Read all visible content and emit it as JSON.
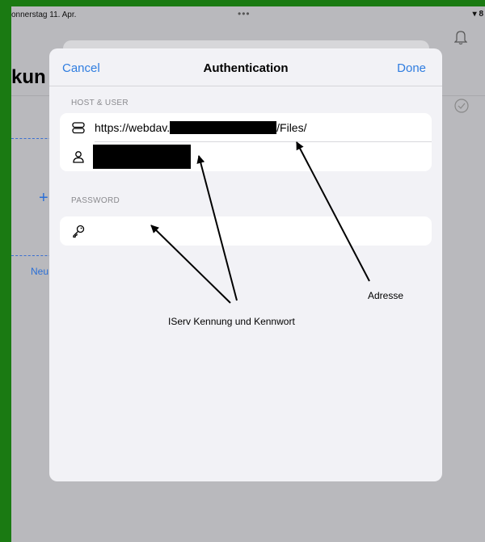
{
  "status_bar": {
    "date": "onnerstag 11. Apr.",
    "dots": "•••",
    "right": "8"
  },
  "background": {
    "title": "kun",
    "new_label": "Neu",
    "plus_symbol": "+"
  },
  "sheet": {
    "nav": {
      "cancel": "Cancel",
      "title": "Authentication",
      "done": "Done"
    },
    "host_section": {
      "header": "HOST & USER",
      "url_prefix": "https://webdav.",
      "url_suffix": "/Files/"
    },
    "password_section": {
      "header": "PASSWORD"
    }
  },
  "annotations": {
    "address": "Adresse",
    "credentials": "IServ Kennung und Kennwort"
  },
  "colors": {
    "accent": "#2f7de0",
    "frame": "#1a7a12"
  }
}
